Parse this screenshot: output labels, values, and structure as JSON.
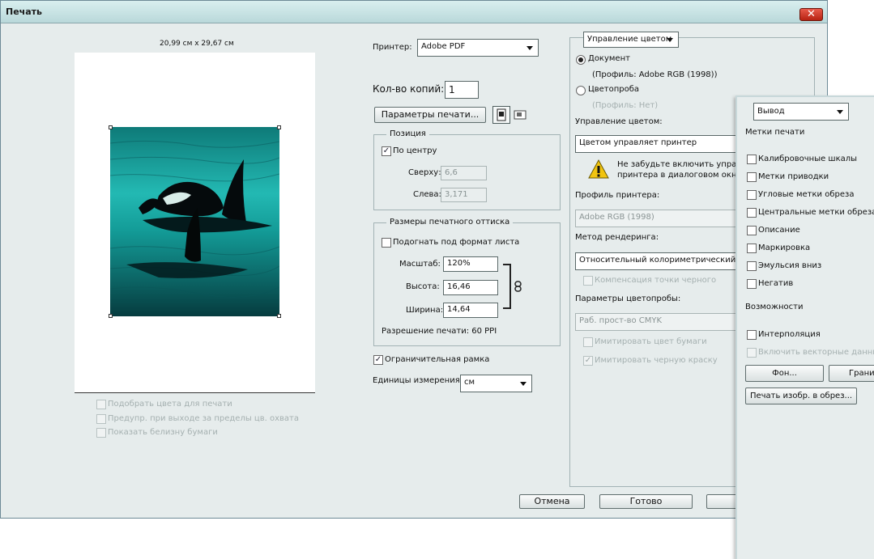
{
  "window": {
    "title": "Печать",
    "close_glyph": "✕"
  },
  "preview": {
    "dimensions": "20,99 см x 29,67 см"
  },
  "preview_options": [
    "Подобрать цвета для печати",
    "Предупр. при выходе за пределы цв. охвата",
    "Показать белизну бумаги"
  ],
  "printer": {
    "label": "Принтер:",
    "value": "Adobe PDF"
  },
  "copies": {
    "label": "Кол-во копий:",
    "value": "1"
  },
  "print_settings_button": "Параметры печати...",
  "position": {
    "title": "Позиция",
    "center_label": "По центру",
    "top_label": "Сверху:",
    "top_value": "6,6",
    "left_label": "Слева:",
    "left_value": "3,171"
  },
  "print_size": {
    "title": "Размеры печатного оттиска",
    "fit_label": "Подогнать под формат листа",
    "scale_label": "Масштаб:",
    "scale_value": "120%",
    "height_label": "Высота:",
    "height_value": "16,46",
    "width_label": "Ширина:",
    "width_value": "14,64",
    "resolution": "Разрешение печати: 60 PPI"
  },
  "bounding_box_label": "Ограничительная рамка",
  "units": {
    "label": "Единицы измерения:",
    "value": "см"
  },
  "color_management": {
    "section_select": "Управление цветом",
    "document_label": "Документ",
    "document_profile": "(Профиль: Adobe RGB (1998))",
    "proof_label": "Цветопроба",
    "proof_profile": "(Профиль: Нет)",
    "handling_label": "Управление цветом:",
    "handling_value": "Цветом управляет принтер",
    "warning_line1": "Не забудьте включить управле",
    "warning_line2": "принтера в диалоговом окне п",
    "printer_profile_label": "Профиль принтера:",
    "printer_profile_value": "Adobe RGB (1998)",
    "rendering_label": "Метод рендеринга:",
    "rendering_value": "Относительный колориметрический",
    "black_point_label": "Компенсация точки черного",
    "proof_setup_label": "Параметры цветопробы:",
    "proof_setup_value": "Раб. прост-во CMYK",
    "simulate_paper_label": "Имитировать цвет бумаги",
    "simulate_black_label": "Имитировать черную краску"
  },
  "buttons": {
    "cancel": "Отмена",
    "done": "Готово"
  },
  "output_panel": {
    "section_select": "Вывод",
    "marks_title": "Метки печати",
    "marks": [
      "Калибровочные шкалы",
      "Метки приводки",
      "Угловые метки обреза",
      "Центральные метки обреза",
      "Описание",
      "Маркировка",
      "Эмульсия вниз",
      "Негатив"
    ],
    "functions_title": "Возможности",
    "interpolation_label": "Интерполяция",
    "vector_label": "Включить векторные данные",
    "background_button": "Фон...",
    "border_button": "Границ",
    "bleed_button": "Печать изобр. в обрез..."
  }
}
